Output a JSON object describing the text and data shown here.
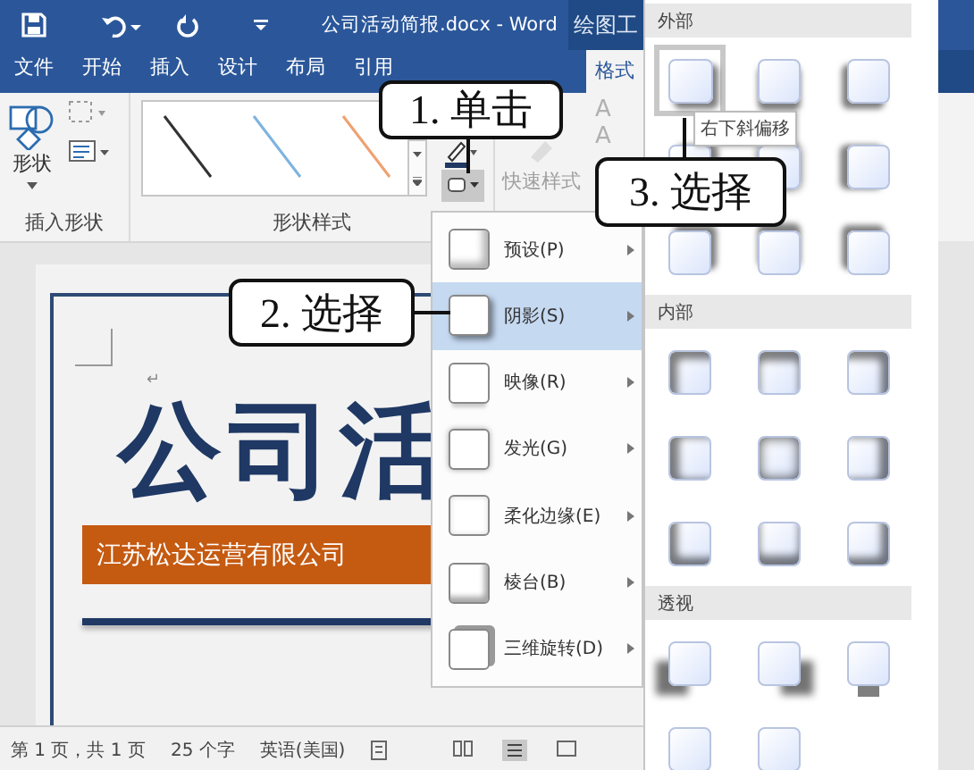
{
  "title_bar": {
    "title": "公司活动简报.docx - Word",
    "context_tab": "绘图工"
  },
  "tabs": [
    {
      "label": "文件",
      "selected": false
    },
    {
      "label": "开始",
      "selected": false
    },
    {
      "label": "插入",
      "selected": false
    },
    {
      "label": "设计",
      "selected": false
    },
    {
      "label": "布局",
      "selected": false
    },
    {
      "label": "引用",
      "selected": false
    },
    {
      "label": "格式",
      "selected": true
    }
  ],
  "ribbon": {
    "shape_button": "形状",
    "groups": [
      "插入形状",
      "形状样式"
    ],
    "quick_styles": "快速样式",
    "wordart": [
      "A",
      "A"
    ]
  },
  "document": {
    "paragraph_mark": "↵",
    "title": "公司活",
    "company": "江苏松达运营有限公司"
  },
  "status_bar": {
    "page": "第 1 页，共 1 页",
    "words": "25 个字",
    "language": "英语(美国)"
  },
  "menu": {
    "items": [
      {
        "label": "预设(P)",
        "kind": "preset",
        "selected": false
      },
      {
        "label": "阴影(S)",
        "kind": "shadow",
        "selected": true
      },
      {
        "label": "映像(R)",
        "kind": "reflection",
        "selected": false
      },
      {
        "label": "发光(G)",
        "kind": "glow",
        "selected": false
      },
      {
        "label": "柔化边缘(E)",
        "kind": "soft",
        "selected": false
      },
      {
        "label": "棱台(B)",
        "kind": "bevel",
        "selected": false
      },
      {
        "label": "三维旋转(D)",
        "kind": "rotation",
        "selected": false
      }
    ]
  },
  "gallery": {
    "sections": [
      {
        "title": "外部",
        "cells": [
          {
            "kind": "br",
            "selected": true
          },
          {
            "kind": "b",
            "selected": false
          },
          {
            "kind": "bl",
            "selected": false
          },
          {
            "kind": "r",
            "selected": false
          },
          {
            "kind": "c",
            "selected": false
          },
          {
            "kind": "l",
            "selected": false
          },
          {
            "kind": "tr",
            "selected": false
          },
          {
            "kind": "t",
            "selected": false
          },
          {
            "kind": "tl",
            "selected": false
          }
        ]
      },
      {
        "title": "内部",
        "cells": [
          {
            "kind": "itl",
            "selected": false
          },
          {
            "kind": "it",
            "selected": false
          },
          {
            "kind": "itr",
            "selected": false
          },
          {
            "kind": "il",
            "selected": false
          },
          {
            "kind": "ic",
            "selected": false
          },
          {
            "kind": "ir",
            "selected": false
          },
          {
            "kind": "ibl",
            "selected": false
          },
          {
            "kind": "ib",
            "selected": false
          },
          {
            "kind": "ibr",
            "selected": false
          }
        ]
      },
      {
        "title": "透视",
        "cells": [
          {
            "kind": "pl",
            "selected": false
          },
          {
            "kind": "pr",
            "selected": false
          },
          {
            "kind": "pb",
            "selected": false
          },
          {
            "kind": "pu",
            "selected": false
          },
          {
            "kind": "pu",
            "selected": false
          }
        ]
      }
    ]
  },
  "tooltip": "右下斜偏移",
  "callouts": [
    {
      "text": "1. 单击"
    },
    {
      "text": "2. 选择"
    },
    {
      "text": "3. 选择"
    }
  ]
}
